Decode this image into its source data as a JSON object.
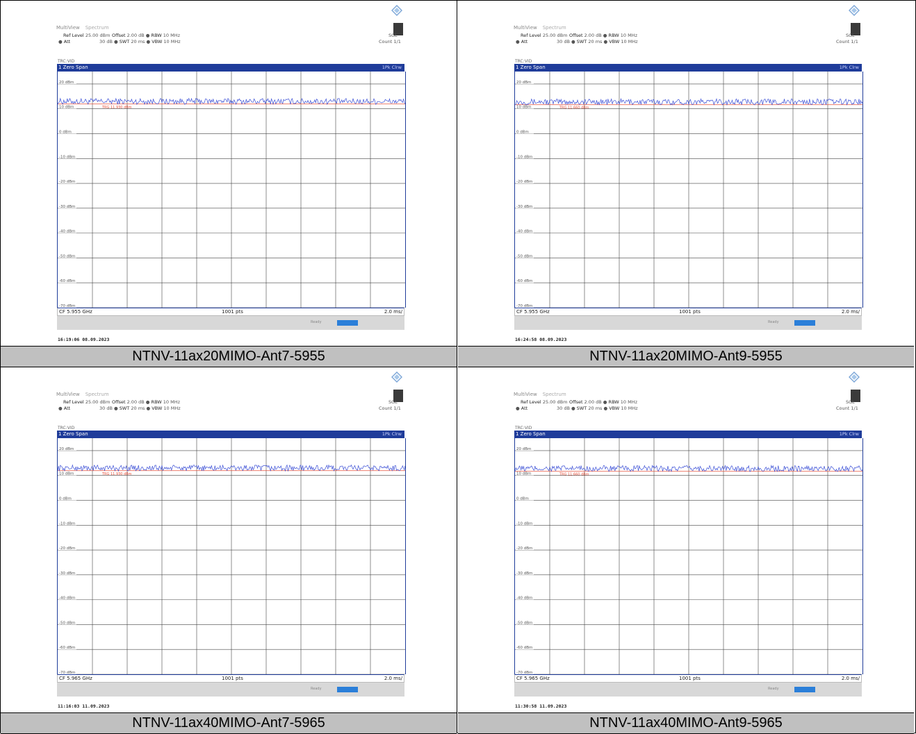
{
  "panels": [
    {
      "caption": "NTNV-11ax20MIMO-Ant7-5955",
      "tab1": "MultiView",
      "tab2": "Spectrum",
      "ref_level": "Ref Level",
      "ref_level_value": "25.00 dBm",
      "offset": "Offset",
      "offset_value": "2.00 dB",
      "rbw": "RBW",
      "rbw_value": "10 MHz",
      "att": "Att",
      "att_value": "30 dB",
      "swt": "SWT",
      "swt_value": "20 ms",
      "vbw": "VBW",
      "vbw_value": "10 MHz",
      "sgl": "SGL",
      "count": "Count 1/1",
      "trc": "TRC:VID",
      "span": "1 Zero Span",
      "trace_label": "1Pk Clrw",
      "cf": "CF 5.955 GHz",
      "points": "1001 pts",
      "div": "2.0 ms/",
      "status": "Ready",
      "timestamp": "16:19:06  08.09.2023",
      "tl_label": "TRG 11.930 dBm"
    },
    {
      "caption": "NTNV-11ax20MIMO-Ant9-5955",
      "tab1": "MultiView",
      "tab2": "Spectrum",
      "ref_level": "Ref Level",
      "ref_level_value": "25.00 dBm",
      "offset": "Offset",
      "offset_value": "2.00 dB",
      "rbw": "RBW",
      "rbw_value": "10 MHz",
      "att": "Att",
      "att_value": "30 dB",
      "swt": "SWT",
      "swt_value": "20 ms",
      "vbw": "VBW",
      "vbw_value": "10 MHz",
      "sgl": "SGL",
      "count": "Count 1/1",
      "trc": "TRC:VID",
      "span": "1 Zero Span",
      "trace_label": "1Pk Clrw",
      "cf": "CF 5.955 GHz",
      "points": "1001 pts",
      "div": "2.0 ms/",
      "status": "Ready",
      "timestamp": "16:24:58  08.09.2023",
      "tl_label": "TRG 11.660 dBm"
    },
    {
      "caption": "NTNV-11ax40MIMO-Ant7-5965",
      "tab1": "MultiView",
      "tab2": "Spectrum",
      "ref_level": "Ref Level",
      "ref_level_value": "25.00 dBm",
      "offset": "Offset",
      "offset_value": "2.00 dB",
      "rbw": "RBW",
      "rbw_value": "10 MHz",
      "att": "Att",
      "att_value": "30 dB",
      "swt": "SWT",
      "swt_value": "20 ms",
      "vbw": "VBW",
      "vbw_value": "10 MHz",
      "sgl": "SGL",
      "count": "Count 1/1",
      "trc": "TRC:VID",
      "span": "1 Zero Span",
      "trace_label": "1Pk Clrw",
      "cf": "CF 5.965 GHz",
      "points": "1001 pts",
      "div": "2.0 ms/",
      "status": "Ready",
      "timestamp": "11:16:03  11.09.2023",
      "tl_label": "TRG 11.930 dBm"
    },
    {
      "caption": "NTNV-11ax40MIMO-Ant9-5965",
      "tab1": "MultiView",
      "tab2": "Spectrum",
      "ref_level": "Ref Level",
      "ref_level_value": "25.00 dBm",
      "offset": "Offset",
      "offset_value": "2.00 dB",
      "rbw": "RBW",
      "rbw_value": "10 MHz",
      "att": "Att",
      "att_value": "30 dB",
      "swt": "SWT",
      "swt_value": "20 ms",
      "vbw": "VBW",
      "vbw_value": "10 MHz",
      "sgl": "SGL",
      "count": "Count 1/1",
      "trc": "TRC:VID",
      "span": "1 Zero Span",
      "trace_label": "1Pk Clrw",
      "cf": "CF 5.965 GHz",
      "points": "1001 pts",
      "div": "2.0 ms/",
      "status": "Ready",
      "timestamp": "11:30:58  11.09.2023",
      "tl_label": "TRG 11.660 dBm"
    }
  ],
  "colors": {
    "header_bar": "#1f3c9a",
    "trace": "#3b4fd6",
    "threshold": "#e8503a",
    "caption_bg": "#c0c0c0"
  },
  "chart_data": [
    {
      "type": "line",
      "ylim": [
        -70,
        25
      ],
      "y_ticks": [
        "20 dBm",
        "10 dBm",
        "0 dBm",
        "-10 dBm",
        "-20 dBm",
        "-30 dBm",
        "-40 dBm",
        "-50 dBm",
        "-60 dBm",
        "-70 dBm"
      ],
      "threshold_dbm": 11.93,
      "trace_level_dbm": 13.0,
      "trace_noise_dbm": 1.2
    },
    {
      "type": "line",
      "ylim": [
        -70,
        25
      ],
      "y_ticks": [
        "20 dBm",
        "10 dBm",
        "0 dBm",
        "-10 dBm",
        "-20 dBm",
        "-30 dBm",
        "-40 dBm",
        "-50 dBm",
        "-60 dBm",
        "-70 dBm"
      ],
      "threshold_dbm": 11.66,
      "trace_level_dbm": 12.8,
      "trace_noise_dbm": 1.2
    },
    {
      "type": "line",
      "ylim": [
        -70,
        25
      ],
      "y_ticks": [
        "20 dBm",
        "10 dBm",
        "0 dBm",
        "-10 dBm",
        "-20 dBm",
        "-30 dBm",
        "-40 dBm",
        "-50 dBm",
        "-60 dBm",
        "-70 dBm"
      ],
      "threshold_dbm": 11.93,
      "trace_level_dbm": 13.0,
      "trace_noise_dbm": 1.2
    },
    {
      "type": "line",
      "ylim": [
        -70,
        25
      ],
      "y_ticks": [
        "20 dBm",
        "10 dBm",
        "0 dBm",
        "-10 dBm",
        "-20 dBm",
        "-30 dBm",
        "-40 dBm",
        "-50 dBm",
        "-60 dBm",
        "-70 dBm"
      ],
      "threshold_dbm": 11.66,
      "trace_level_dbm": 12.8,
      "trace_noise_dbm": 1.2
    }
  ]
}
